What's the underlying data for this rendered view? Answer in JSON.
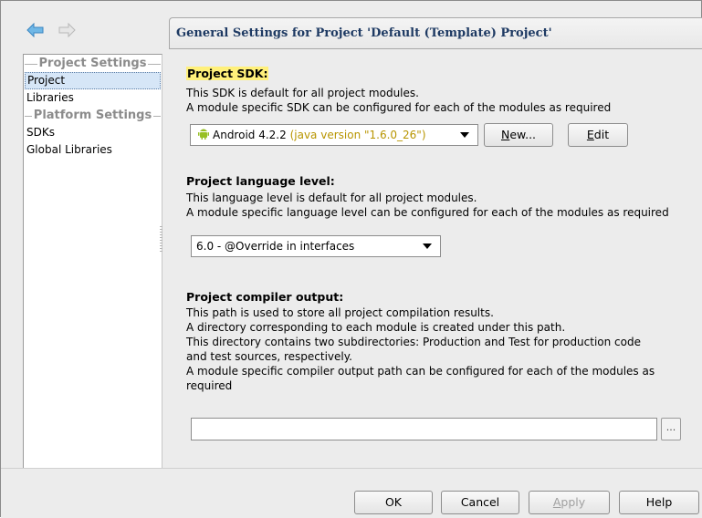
{
  "nav": {
    "back_icon": "back-arrow-icon",
    "forward_icon": "forward-arrow-icon"
  },
  "sidebar": {
    "project_settings_header": "Project Settings",
    "project_items": [
      {
        "label": "Project",
        "selected": true
      },
      {
        "label": "Libraries",
        "selected": false
      }
    ],
    "platform_settings_header": "Platform Settings",
    "platform_items": [
      {
        "label": "SDKs",
        "selected": false
      },
      {
        "label": "Global Libraries",
        "selected": false
      }
    ]
  },
  "header": {
    "title": "General Settings for Project 'Default (Template) Project'"
  },
  "sdk": {
    "title": "Project SDK:",
    "desc_line1": "This SDK is default for all project modules.",
    "desc_line2": "A module specific SDK can be configured for each of the modules as required",
    "selected_name": "Android 4.2.2",
    "selected_java": "(java version \"1.6.0_26\")",
    "icon": "android-icon",
    "new_label": "New...",
    "edit_label": "Edit"
  },
  "language": {
    "title": "Project language level:",
    "desc_line1": "This language level is default for all project modules.",
    "desc_line2": "A module specific language level can be configured for each of the modules as required",
    "selected": "6.0 - @Override in interfaces"
  },
  "compiler_output": {
    "title": "Project compiler output:",
    "lines": [
      "This path is used to store all project compilation results.",
      "A directory corresponding to each module is created under this path.",
      "This directory contains two subdirectories: Production and Test for production code",
      "and test sources, respectively.",
      "A module specific compiler output path can be configured for each of the modules as",
      "required"
    ],
    "value": "",
    "browse_label": "..."
  },
  "footer": {
    "ok_label": "OK",
    "cancel_label": "Cancel",
    "apply_label": "Apply",
    "help_label": "Help"
  },
  "colors": {
    "header_title": "#1e3a63",
    "sdk_highlight": "#fff07a",
    "java_version": "#b89500",
    "selection": "#d6e6f7"
  }
}
